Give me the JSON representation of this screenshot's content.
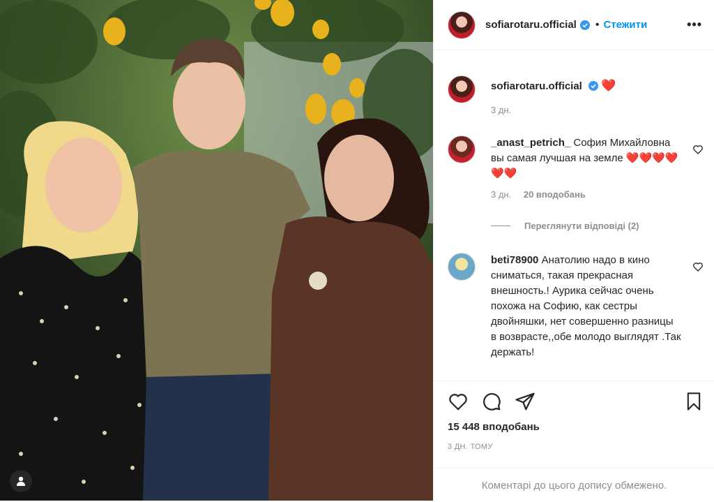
{
  "post": {
    "username": "sofiarotaru.official",
    "follow_label": "Стежити",
    "more_label": "•••",
    "separator": "•"
  },
  "caption": {
    "username": "sofiarotaru.official",
    "text": "❤️",
    "time": "3 дн."
  },
  "comments": [
    {
      "username": "_anast_petrich_",
      "text": "София Михайловна вы самая лучшая на земле ❤️❤️❤️❤️❤️❤️",
      "time": "3 дн.",
      "likes": "20 вподобань"
    },
    {
      "username": "beti78900",
      "text": "Анатолию надо в кино сниматься, такая прекрасная внешность.! Аурика сейчас очень похожа на Софию, как сестры двойняшки, нет совершенно разницы в возврасте,,обе молодо выглядят .Так держать!"
    }
  ],
  "replies_label": "Переглянути відповіді (2)",
  "likes_count": "15 448 вподобань",
  "date": "3 ДН. ТОМУ",
  "comments_limited": "Коментарі до цього допису обмежено.",
  "colors": {
    "accent": "#0095f6",
    "text": "#262626",
    "secondary": "#8e8e8e",
    "heart": "#ed4956"
  }
}
